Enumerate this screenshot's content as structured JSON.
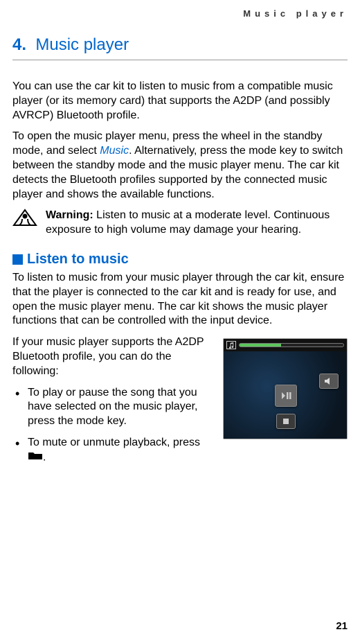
{
  "running_header": "Music player",
  "chapter": {
    "number": "4.",
    "title": "Music player"
  },
  "para1": "You can use the car kit to listen to music from a compatible music player (or its memory card) that supports the A2DP (and possibly AVRCP) Bluetooth profile.",
  "para2a": "To open the music player menu, press the wheel in the standby mode, and select ",
  "para2_link": "Music",
  "para2b": ". Alternatively, press the mode key to switch between the standby mode and the music player menu. The car kit detects the Bluetooth profiles supported by the connected music player and shows the available functions.",
  "warning": {
    "label": "Warning:",
    "text": " Listen to music at a moderate level. Continuous exposure to high volume may damage your hearing."
  },
  "section_heading": "Listen to music",
  "para3": "To listen to music from your music player through the car kit, ensure that the player is connected to the car kit and is ready for use, and open the music player menu. The car kit shows the music player functions that can be controlled with the input device.",
  "para4": "If your music player supports the A2DP Bluetooth profile, you can do the following:",
  "bullets": [
    "To play or pause the song that you have selected on the music player, press the mode key.",
    "To mute or unmute playback, press "
  ],
  "bullet2_suffix": ".",
  "page_number": "21"
}
